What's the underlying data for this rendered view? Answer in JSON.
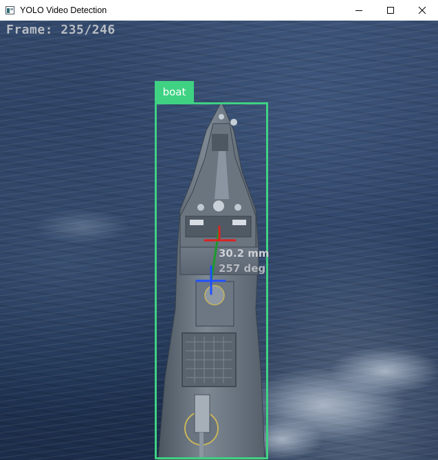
{
  "window": {
    "title": "YOLO Video Detection",
    "icon": "app-window-icon",
    "controls": [
      "minimize-icon",
      "maximize-icon",
      "close-icon"
    ]
  },
  "overlay": {
    "frame_counter": "Frame: 235/246",
    "detection": {
      "label": "boat",
      "box_color": "#3fd283"
    },
    "measurement": {
      "distance": "30.2 mm",
      "angle": "257 deg"
    },
    "axis_colors": {
      "x": "#e02020",
      "y": "#1a9a2a",
      "z": "#2050ff"
    }
  }
}
